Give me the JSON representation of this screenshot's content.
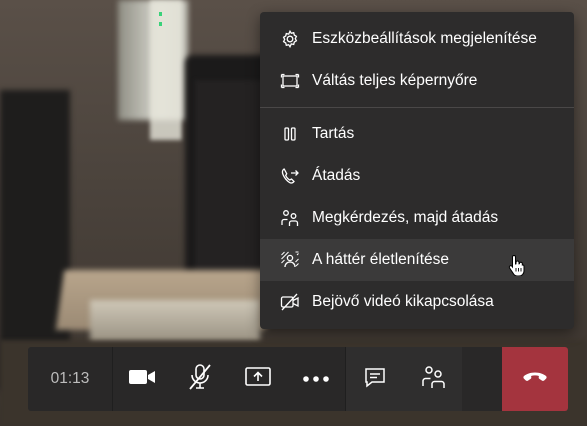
{
  "menu": {
    "items": [
      {
        "label": "Eszközbeállítások megjelenítése",
        "icon": "gear-icon"
      },
      {
        "label": "Váltás teljes képernyőre",
        "icon": "fullscreen-icon"
      },
      {
        "label": "Tartás",
        "icon": "pause-icon"
      },
      {
        "label": "Átadás",
        "icon": "transfer-call-icon"
      },
      {
        "label": "Megkérdezés, majd átadás",
        "icon": "consult-transfer-icon"
      },
      {
        "label": "A háttér életlenítése",
        "icon": "blur-background-icon"
      },
      {
        "label": "Bejövő videó kikapcsolása",
        "icon": "video-off-icon"
      }
    ],
    "hovered_index": 5
  },
  "call_bar": {
    "timer": "01:13",
    "buttons": [
      {
        "icon": "camera-icon"
      },
      {
        "icon": "microphone-muted-icon"
      },
      {
        "icon": "share-screen-icon"
      },
      {
        "icon": "more-options-icon"
      },
      {
        "icon": "chat-icon"
      },
      {
        "icon": "participants-icon"
      },
      {
        "icon": "hang-up-icon"
      }
    ]
  },
  "colors": {
    "menu_bg": "#2d2c2c",
    "menu_hover": "#3b3a3a",
    "bar_bg": "#292828",
    "hangup": "#a4343e",
    "text": "#ffffff",
    "timer_text": "#bdbdbd"
  }
}
